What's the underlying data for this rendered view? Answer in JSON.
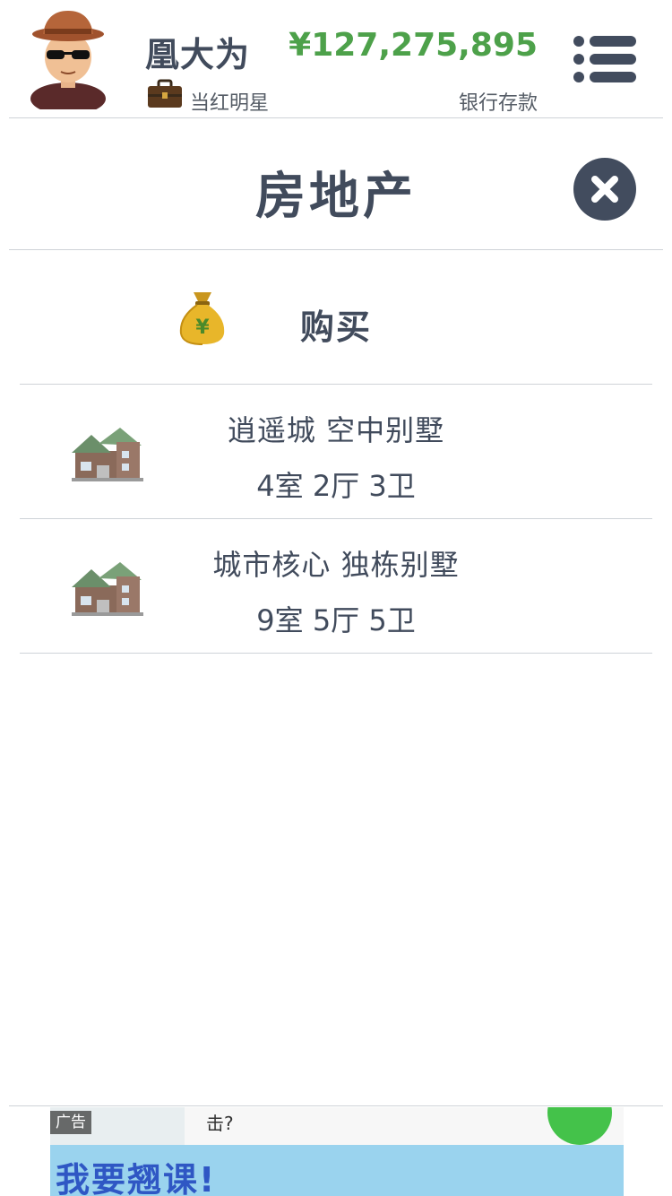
{
  "header": {
    "player_name": "凰大为",
    "job_title": "当红明星",
    "money": "¥127,275,895",
    "money_label": "银行存款",
    "menu_icon": "list-menu-icon"
  },
  "page": {
    "title": "房地产",
    "close_icon": "close-icon"
  },
  "buy": {
    "label": "购买",
    "icon": "money-bag-icon"
  },
  "properties": [
    {
      "name": "逍遥城 空中别墅",
      "rooms": "4室 2厅 3卫",
      "icon": "house-icon"
    },
    {
      "name": "城市核心 独栋别墅",
      "rooms": "9室 5厅 5卫",
      "icon": "house-icon"
    }
  ],
  "ad": {
    "badge": "广告",
    "text": "击?",
    "banner_text": "我要翘课!"
  },
  "colors": {
    "primary_text": "#414b5c",
    "money_green": "#4da14a",
    "close_button": "#424c5e",
    "divider": "#cfd3d8"
  }
}
